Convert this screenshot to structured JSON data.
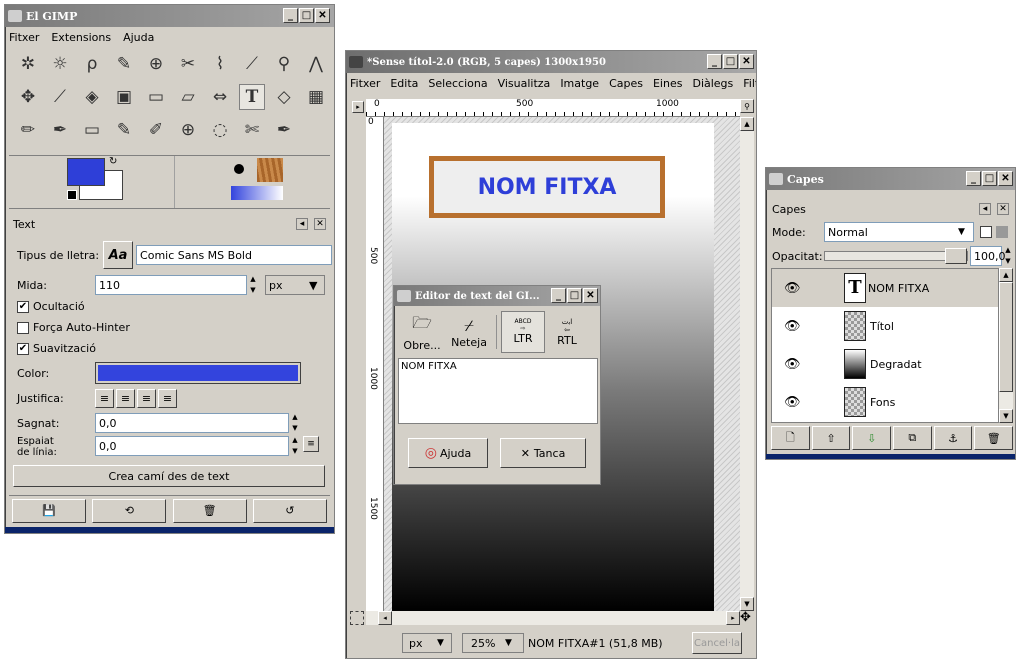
{
  "toolbox": {
    "title": "El GIMP",
    "menu": [
      "Fitxer",
      "Extensions",
      "Ajuda"
    ],
    "tools": [
      [
        "✲",
        "☼",
        "ρ",
        "✎",
        "⊕",
        "✂",
        "⌇",
        "⟋",
        "⚲",
        "⋀"
      ],
      [
        "✥",
        "⟋",
        "◈",
        "▣",
        "▭",
        "▱",
        "⇔",
        "T",
        "◇",
        "▦"
      ],
      [
        "✏",
        "✒",
        "▭",
        "✎",
        "✐",
        "⊕",
        "◌",
        "✄",
        "✒"
      ]
    ],
    "text_panel": {
      "title": "Text",
      "font_label": "Tipus de lletra:",
      "font_preview": "Aa",
      "font_value": "Comic Sans MS Bold",
      "size_label": "Mida:",
      "size_value": "110",
      "unit_value": "px",
      "hinting_label": "Ocultació",
      "autohint_label": "Força Auto-Hinter",
      "antialias_label": "Suavització",
      "color_label": "Color:",
      "text_color": "#3344dd",
      "justify_label": "Justifica:",
      "indent_label": "Sagnat:",
      "indent_value": "0,0",
      "spacing_label_1": "Espaiat",
      "spacing_label_2": "de línia:",
      "spacing_value": "0,0",
      "path_button": "Crea camí des de text"
    },
    "fg_color": "#2e3fd8",
    "bg_color": "#ffffff"
  },
  "image_window": {
    "title": "*Sense títol-2.0 (RGB, 5 capes) 1300x1950",
    "menu": [
      "Fitxer",
      "Edita",
      "Selecciona",
      "Visualitza",
      "Imatge",
      "Capes",
      "Eines",
      "Diàlegs",
      "Filt"
    ],
    "ruler_h": [
      "0",
      "500",
      "1000"
    ],
    "ruler_v": [
      "0",
      "500",
      "1000",
      "1500"
    ],
    "canvas_title": "NOM FITXA",
    "unit": "px",
    "zoom": "25%",
    "status": "NOM FITXA#1 (51,8 MB)",
    "cancel": "Cancel·la"
  },
  "text_editor": {
    "title": "Editor de text del GI...",
    "open_label": "Obre...",
    "clear_label": "Neteja",
    "ltr_label": "LTR",
    "rtl_label": "RTL",
    "ltr_icon_text": "ABCD",
    "rtl_icon_text": "ﺍﺑﺕ",
    "content": "NOM FITXA",
    "help_label": "Ajuda",
    "close_label": "Tanca"
  },
  "layers": {
    "title": "Capes",
    "panel_label": "Capes",
    "mode_label": "Mode:",
    "mode_value": "Normal",
    "opacity_label": "Opacitat:",
    "opacity_value": "100,0",
    "items": [
      {
        "name": "NOM FITXA"
      },
      {
        "name": "Títol"
      },
      {
        "name": "Degradat"
      },
      {
        "name": "Fons"
      }
    ]
  }
}
